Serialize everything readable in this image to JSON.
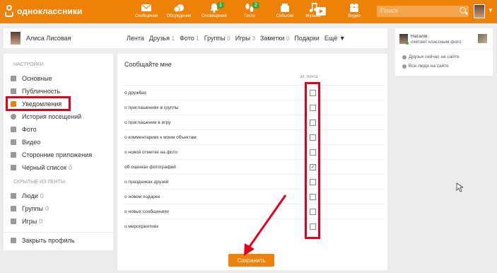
{
  "brand": {
    "name": "одноклассники",
    "accent": "#ee8208"
  },
  "topnav": [
    {
      "label": "Сообщения",
      "icon": "envelope-icon",
      "badge": ""
    },
    {
      "label": "Обсуждения",
      "icon": "chat-bubbles-icon",
      "badge": ""
    },
    {
      "label": "Оповещения",
      "icon": "bell-icon",
      "badge": "1"
    },
    {
      "label": "Гости",
      "icon": "footprints-icon",
      "badge": "2"
    },
    {
      "label": "События",
      "icon": "events-icon",
      "badge": ""
    },
    {
      "label": "Музыка",
      "icon": "music-note-icon",
      "badge": ""
    },
    {
      "label": "Видео",
      "icon": "film-camera-icon",
      "badge": ""
    }
  ],
  "search": {
    "placeholder": "Поиск"
  },
  "profile": {
    "name": "Алиса Лисовая",
    "tabs": [
      {
        "label": "Лента",
        "count": ""
      },
      {
        "label": "Друзья",
        "count": "1"
      },
      {
        "label": "Фото",
        "count": "1"
      },
      {
        "label": "Группы",
        "count": "0"
      },
      {
        "label": "Игры",
        "count": "3"
      },
      {
        "label": "Заметки",
        "count": "0"
      },
      {
        "label": "Подарки",
        "count": ""
      },
      {
        "label": "Ещё ▼",
        "count": ""
      }
    ]
  },
  "sidebar": {
    "settings_header": "НАСТРОЙКИ",
    "items": [
      {
        "label": "Основные",
        "count": ""
      },
      {
        "label": "Публичность",
        "count": ""
      },
      {
        "label": "Уведомления",
        "count": ""
      },
      {
        "label": "История посещений",
        "count": ""
      },
      {
        "label": "Фото",
        "count": ""
      },
      {
        "label": "Видео",
        "count": ""
      },
      {
        "label": "Сторонние приложения",
        "count": ""
      },
      {
        "label": "Черный список",
        "count": "0"
      }
    ],
    "hidden_header": "СКРЫТЫЕ ИЗ ЛЕНТЫ",
    "hidden_items": [
      {
        "label": "Люди",
        "count": "0"
      },
      {
        "label": "Группы",
        "count": "0"
      },
      {
        "label": "Игры",
        "count": "0"
      }
    ],
    "close_profile": "Закрыть профиль"
  },
  "main": {
    "title": "Сообщайте мне",
    "column_header": "эл. почта",
    "rows": [
      {
        "label": "о дружбах",
        "checked": false
      },
      {
        "label": "о приглашениях в группы",
        "checked": false
      },
      {
        "label": "о приглашении в игру",
        "checked": false
      },
      {
        "label": "о комментариях к моим объектам",
        "checked": false
      },
      {
        "label": "о новой отметке на фото",
        "checked": false
      },
      {
        "label": "об оценках фотографий",
        "checked": true
      },
      {
        "label": "о праздниках друзей",
        "checked": false
      },
      {
        "label": "о новом подарке",
        "checked": false
      },
      {
        "label": "о новых сообщениях",
        "checked": false
      },
      {
        "label": "о мероприятиях",
        "checked": false
      }
    ],
    "save_label": "Сохранить"
  },
  "right": {
    "friend_name": "Наталія",
    "friend_action": "считает классным фото",
    "link_online": "Друзья сейчас на сайте",
    "link_all": "Все люди на сайте"
  },
  "colors": {
    "highlight": "#e0001b",
    "bar": "#ee8208"
  }
}
